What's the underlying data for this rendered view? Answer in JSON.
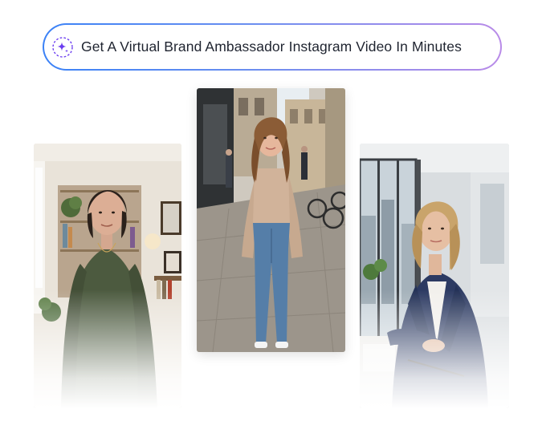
{
  "banner": {
    "icon": "sparkles-icon",
    "text": "Get A Virtual Brand Ambassador Instagram Video In Minutes",
    "gradient_start": "#3b82f6",
    "gradient_end": "#b98be8",
    "icon_color": "#6b3df0"
  },
  "gallery": {
    "cards": [
      {
        "subject": "woman-green-sweater-home-office"
      },
      {
        "subject": "woman-jeans-street"
      },
      {
        "subject": "woman-blazer-office-window"
      }
    ]
  }
}
